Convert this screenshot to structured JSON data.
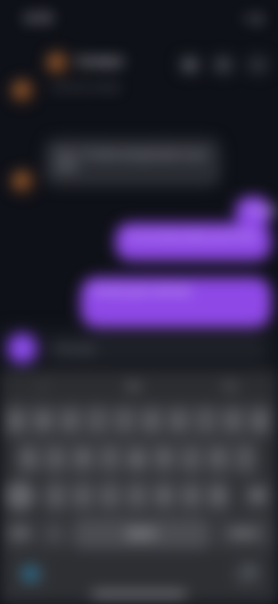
{
  "status": {
    "time": "16:08",
    "icons": "•••  ▮"
  },
  "header": {
    "name": "Contact",
    "subtitle": "Last seen recently",
    "actions": [
      "☎",
      "⌘",
      "⋯"
    ]
  },
  "messages": [
    {
      "dir": "in",
      "text": "Sure, I’ll check and get back to you soon."
    },
    {
      "dir": "out",
      "text": "Thanks!"
    },
    {
      "dir": "out",
      "text": "Let me know when you’re free."
    },
    {
      "dir": "out",
      "text": "Sounds good, talk later."
    }
  ],
  "composer": {
    "plus": "+",
    "placeholder": "Message"
  },
  "keyboard": {
    "suggestions": [
      "I",
      "the",
      "I’m"
    ],
    "row1": [
      "q",
      "w",
      "e",
      "r",
      "t",
      "y",
      "u",
      "i",
      "o",
      "p"
    ],
    "row2": [
      "a",
      "s",
      "d",
      "f",
      "g",
      "h",
      "j",
      "k",
      "l"
    ],
    "row3": [
      "⇧",
      "z",
      "x",
      "c",
      "v",
      "b",
      "n",
      "m",
      "⌫"
    ],
    "row4": [
      "123",
      "☺",
      "space",
      "return"
    ],
    "row5": [
      "🌐",
      "🎤"
    ]
  },
  "colors": {
    "background": "#0f1118",
    "outgoing": "#8e48e6",
    "accent": "#7f3ee0",
    "keyboard": "#2d2f33"
  }
}
